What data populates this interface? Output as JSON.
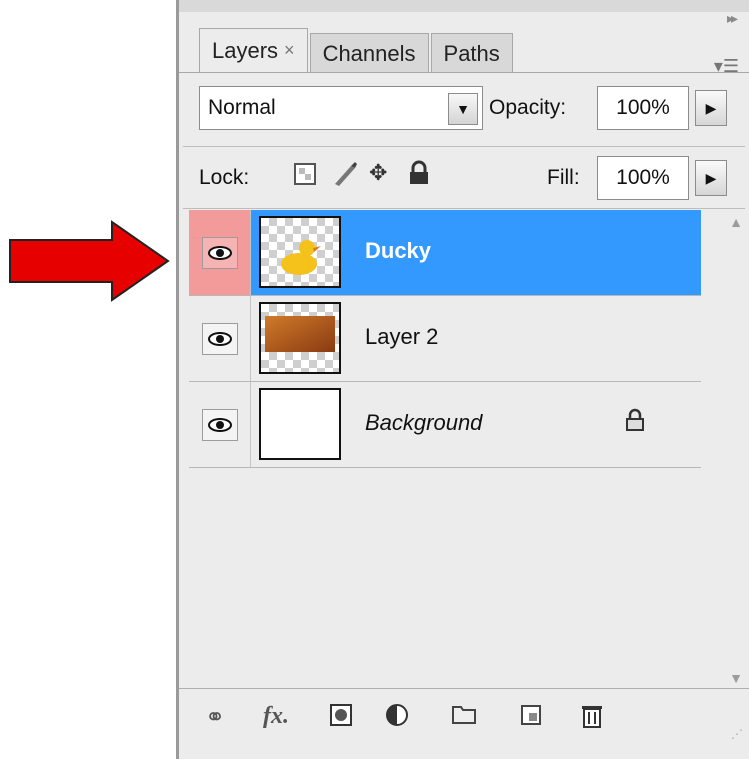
{
  "tabs": [
    {
      "label": "Layers",
      "close": "×",
      "active": true
    },
    {
      "label": "Channels"
    },
    {
      "label": "Paths"
    }
  ],
  "blend_mode": {
    "value": "Normal"
  },
  "opacity": {
    "label": "Opacity:",
    "value": "100%"
  },
  "lock": {
    "label": "Lock:"
  },
  "fill": {
    "label": "Fill:",
    "value": "100%"
  },
  "layers": [
    {
      "name": "Ducky",
      "selected": true,
      "visible": true
    },
    {
      "name": "Layer 2",
      "selected": false,
      "visible": true
    },
    {
      "name": "Background",
      "selected": false,
      "visible": true,
      "locked": true,
      "italic": true
    }
  ],
  "icons": {
    "footer": [
      "link-layers-icon",
      "fx-icon",
      "mask-icon",
      "adjustment-layer-icon",
      "group-folder-icon",
      "new-layer-icon",
      "trash-icon"
    ],
    "lock": [
      "lock-transparent-icon",
      "lock-paint-icon",
      "lock-move-icon",
      "lock-all-icon"
    ]
  },
  "colors": {
    "selection": "#3399ff",
    "selected_eye_bg": "#f39a9a",
    "arrow": "#e60000"
  }
}
